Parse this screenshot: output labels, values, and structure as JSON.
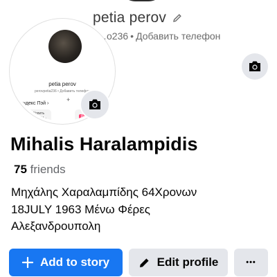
{
  "cover": {
    "name": "petia perov",
    "sub_id": "…o236",
    "sub_sep": "•",
    "sub_action": "Добавить телефон"
  },
  "avatar_screenshot": {
    "name": "petia perov",
    "sub": "perovpetia236 • Добавить телефон",
    "pay_label": "Яндекс Пэй ›",
    "plus": "+",
    "card1_text": "Копить баллы...",
    "card2_icon": "Я"
  },
  "profile": {
    "name": "Mihalis Haralampidis",
    "friends_count": "75",
    "friends_label": "friends",
    "bio_lines": [
      "Μηχάλης Χαραλαμπίδης 64Χρονων",
      "18JULY 1963 Μένω Φέρες",
      "Αλεξανδρουπολη"
    ]
  },
  "actions": {
    "add_story": "Add to story",
    "edit_profile": "Edit profile",
    "more": "•••"
  },
  "colors": {
    "primary": "#1877f2",
    "secondary_bg": "#e4e6eb",
    "text": "#050505",
    "muted": "#65676b"
  },
  "icons": {
    "cover_camera": "camera-icon",
    "avatar_camera": "camera-icon",
    "add_story": "plus-icon",
    "edit_profile": "pencil-icon",
    "cover_edit": "pencil-icon"
  }
}
